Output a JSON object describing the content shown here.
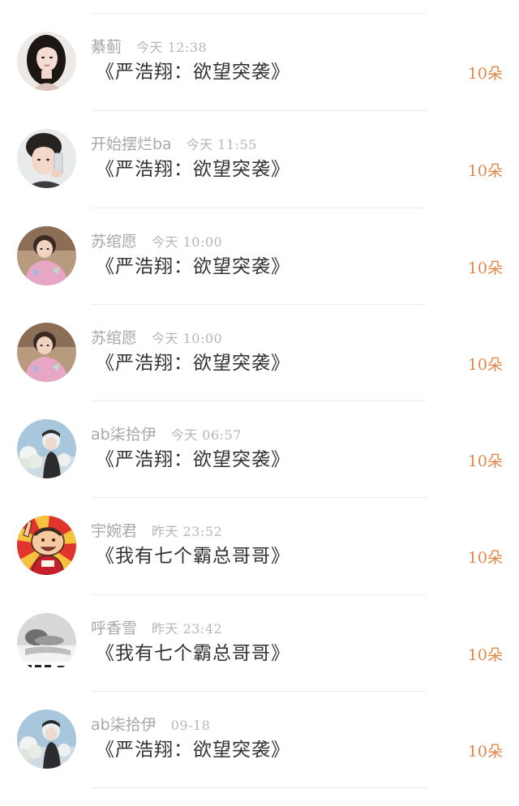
{
  "gifts": [
    {
      "user": "綦蓟",
      "time": "今天 12:38",
      "book": "《严浩翔：欲望突袭》",
      "amount": "10朵",
      "avatar_icon": "avatar-girl-dark-hair-icon"
    },
    {
      "user": "开始摆烂ba",
      "time": "今天 11:55",
      "book": "《严浩翔：欲望突袭》",
      "amount": "10朵",
      "avatar_icon": "avatar-boy-phone-icon"
    },
    {
      "user": "苏绾愿",
      "time": "今天 10:00",
      "book": "《严浩翔：欲望突袭》",
      "amount": "10朵",
      "avatar_icon": "avatar-girl-pink-shirt-icon"
    },
    {
      "user": "苏绾愿",
      "time": "今天 10:00",
      "book": "《严浩翔：欲望突袭》",
      "amount": "10朵",
      "avatar_icon": "avatar-girl-pink-shirt-icon"
    },
    {
      "user": "ab柒拾伊",
      "time": "今天 06:57",
      "book": "《严浩翔：欲望突袭》",
      "amount": "10朵",
      "avatar_icon": "avatar-girl-sky-blossom-icon"
    },
    {
      "user": "宇婉君",
      "time": "昨天 23:52",
      "book": "《我有七个霸总哥哥》",
      "amount": "10朵",
      "avatar_icon": "avatar-cartoon-jersey-icon"
    },
    {
      "user": "呼香雪",
      "time": "昨天 23:42",
      "book": "《我有七个霸总哥哥》",
      "amount": "10朵",
      "avatar_icon": "avatar-grayscale-photo-icon"
    },
    {
      "user": "ab柒拾伊",
      "time": "09-18",
      "book": "《严浩翔：欲望突袭》",
      "amount": "10朵",
      "avatar_icon": "avatar-girl-sky-blossom-icon"
    }
  ],
  "colors": {
    "amount": "#e0874a",
    "username": "#a8a8a8",
    "time": "#b6b6b6",
    "book": "#333333",
    "divider": "#ececec"
  }
}
